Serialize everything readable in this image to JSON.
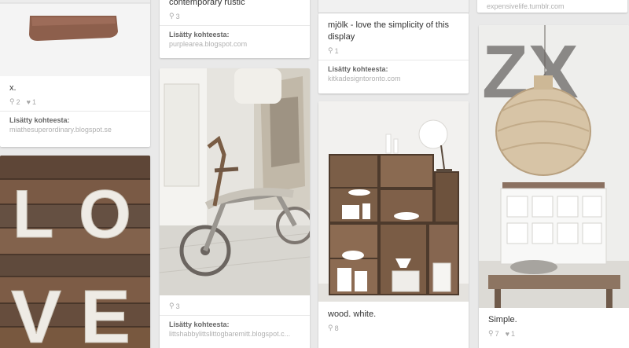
{
  "pins": [
    {
      "id": "p1",
      "description": "x.",
      "repins": "2",
      "likes": "1",
      "source_label": "Lisätty kohteesta:",
      "source_url": "miathesuperordinary.blogspot.se"
    },
    {
      "id": "p2",
      "description": "",
      "repins": "",
      "likes": "",
      "source_label": "",
      "source_url": ""
    },
    {
      "id": "p3",
      "description": "contemporary rustic",
      "repins": "3",
      "likes": "",
      "source_label": "Lisätty kohteesta:",
      "source_url": "purplearea.blogspot.com"
    },
    {
      "id": "p4",
      "description": "",
      "repins": "3",
      "likes": "",
      "source_label": "Lisätty kohteesta:",
      "source_url": "littshabbylittslittogbaremitt.blogspot.c..."
    },
    {
      "id": "p5",
      "description": "mjölk - love the simplicity of this display",
      "repins": "1",
      "likes": "",
      "source_label": "Lisätty kohteesta:",
      "source_url": "kitkadesigntoronto.com"
    },
    {
      "id": "p6",
      "description": "wood. white.",
      "repins": "8",
      "likes": "",
      "source_label": "",
      "source_url": ""
    },
    {
      "id": "p7",
      "description": "",
      "repins": "",
      "likes": "",
      "source_label": "",
      "source_url": "expensivelife.tumblr.com"
    },
    {
      "id": "p8",
      "description": "Simple.",
      "repins": "7",
      "likes": "1",
      "source_label": "",
      "source_url": ""
    }
  ],
  "image_text": {
    "love_letters": [
      "L",
      "O",
      "V",
      "E"
    ],
    "zx_letters": "ZX"
  },
  "icons": {
    "repin": "pin-icon",
    "like": "heart-icon"
  },
  "colors": {
    "background": "#e9e9e9",
    "card": "#ffffff",
    "source_text": "#b0b0b0"
  }
}
